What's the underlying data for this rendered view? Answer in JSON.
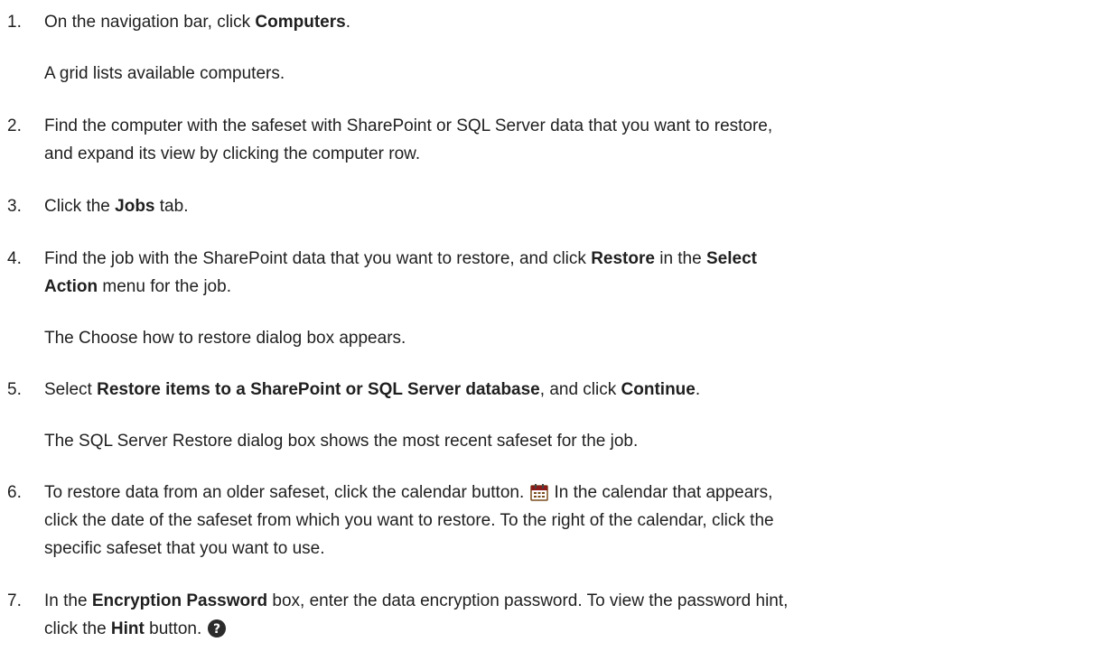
{
  "steps": [
    {
      "number": "1.",
      "parts": [
        "On the navigation bar, click ",
        "Computers",
        "."
      ],
      "result": "A grid lists available computers."
    },
    {
      "number": "2.",
      "line1": "Find the computer with the safeset with SharePoint or SQL Server data that you want to restore,",
      "line2": "and expand its view by clicking the computer row."
    },
    {
      "number": "3.",
      "parts": [
        "Click the ",
        "Jobs",
        " tab."
      ]
    },
    {
      "number": "4.",
      "parts": [
        "Find the job with the SharePoint data that you want to restore, and click ",
        "Restore",
        " in the ",
        "Select"
      ],
      "line2_parts": [
        "Action",
        " menu for the job."
      ],
      "result": "The Choose how to restore dialog box appears."
    },
    {
      "number": "5.",
      "parts": [
        "Select ",
        "Restore items to a SharePoint or SQL Server database",
        ", and click ",
        "Continue",
        "."
      ],
      "result": "The SQL Server Restore dialog box shows the most recent safeset for the job."
    },
    {
      "number": "6.",
      "line1": "To restore data from an older safeset, click the calendar button.",
      "line1_after": "In the calendar that appears,",
      "line2": "click the date of the safeset from which you want to restore. To the right of the calendar, click the",
      "line3": "specific safeset that you want to use.",
      "icon": "calendar-icon"
    },
    {
      "number": "7.",
      "parts": [
        "In the ",
        "Encryption Password",
        " box, enter the data encryption password. To view the password hint,"
      ],
      "line2_parts": [
        "click the ",
        "Hint",
        " button."
      ],
      "icon": "help-icon"
    }
  ]
}
